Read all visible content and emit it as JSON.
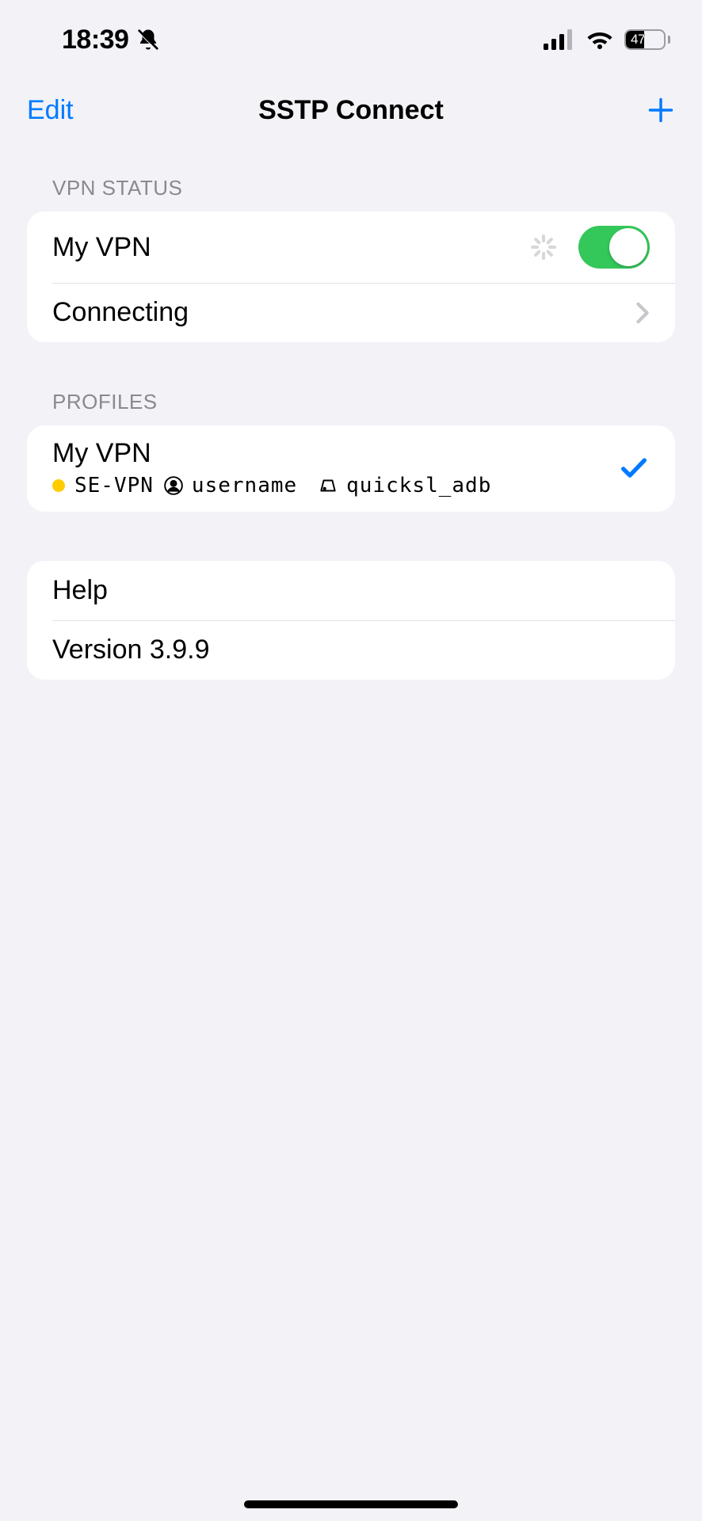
{
  "status_bar": {
    "time": "18:39",
    "battery_pct": "47"
  },
  "nav": {
    "left": "Edit",
    "title": "SSTP Connect"
  },
  "vpn_status": {
    "header": "VPN STATUS",
    "name": "My VPN",
    "toggle_on": true,
    "state": "Connecting"
  },
  "profiles": {
    "header": "PROFILES",
    "items": [
      {
        "name": "My VPN",
        "protocol": "SE-VPN",
        "username": "username",
        "server": "quicksl_adb",
        "selected": true,
        "status_color": "#ffcc00"
      }
    ]
  },
  "info": {
    "help": "Help",
    "version": "Version 3.9.9"
  }
}
